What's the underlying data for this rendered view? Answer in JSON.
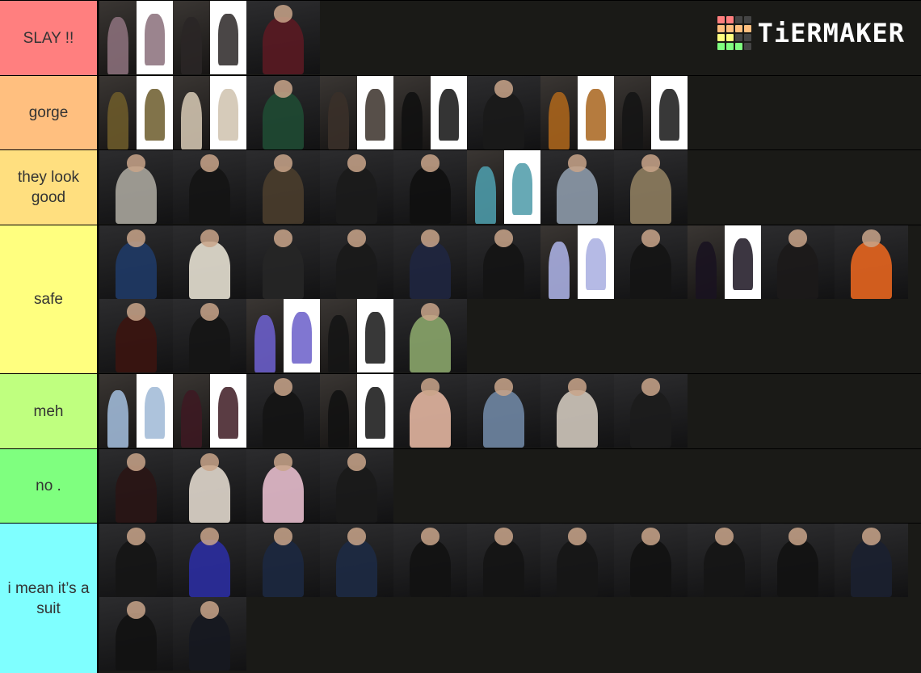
{
  "app": {
    "brand": "TiERMAKER",
    "logo_grid_colors": [
      [
        "#ff7f7f",
        "#ff7f7f",
        "#444444",
        "#444444"
      ],
      [
        "#ffbf7f",
        "#ffbf7f",
        "#ffbf7f",
        "#ffbf7f"
      ],
      [
        "#ffff7f",
        "#ffff7f",
        "#444444",
        "#444444"
      ],
      [
        "#7fff7f",
        "#7fff7f",
        "#7fff7f",
        "#444444"
      ]
    ]
  },
  "tiers": [
    {
      "label": "SLAY !!",
      "color": "#ff7f7f",
      "items": [
        {
          "kind": "split",
          "desc": "floral ball gown photo + product",
          "color": "#8a6f7a"
        },
        {
          "kind": "split",
          "desc": "black floral gown photo + product",
          "color": "#2a2626"
        },
        {
          "kind": "single",
          "desc": "red-black velvet jacket",
          "color": "#5a1a22"
        }
      ]
    },
    {
      "label": "gorge",
      "color": "#ffbf7f",
      "items": [
        {
          "kind": "split",
          "desc": "gold jacquard outfit + product",
          "color": "#6b5a2a"
        },
        {
          "kind": "split",
          "desc": "sequin slit gown + product",
          "color": "#cfc2ae"
        },
        {
          "kind": "single",
          "desc": "green satin gowns at podium",
          "color": "#1f4a33"
        },
        {
          "kind": "split",
          "desc": "lace jumpsuit on red carpet + product",
          "color": "#3a3029"
        },
        {
          "kind": "split",
          "desc": "black caped dress + product",
          "color": "#111111"
        },
        {
          "kind": "single",
          "desc": "black satin slit dress",
          "color": "#1a1a1a"
        },
        {
          "kind": "split",
          "desc": "orange-black corset set + runway",
          "color": "#a8641c"
        },
        {
          "kind": "split",
          "desc": "black ruffle gown + runway",
          "color": "#151515"
        }
      ]
    },
    {
      "label": "they look good",
      "color": "#ffdf7f",
      "items": [
        {
          "kind": "single",
          "desc": "grey blazer white tee",
          "color": "#a9a59c"
        },
        {
          "kind": "single",
          "desc": "two women in black dresses",
          "color": "#141414"
        },
        {
          "kind": "single",
          "desc": "strapless gown at podium",
          "color": "#4a3d2c"
        },
        {
          "kind": "single",
          "desc": "black leather jacket",
          "color": "#1b1b1b"
        },
        {
          "kind": "single",
          "desc": "black coat with quilted bag",
          "color": "#101010"
        },
        {
          "kind": "split",
          "desc": "teal slit gown + product",
          "color": "#4c9aa8"
        },
        {
          "kind": "single",
          "desc": "sparkly silver gowns at podium",
          "color": "#8d9aaa"
        },
        {
          "kind": "single",
          "desc": "group in gold and beige",
          "color": "#8e7d5f"
        }
      ]
    },
    {
      "label": "safe",
      "color": "#ffff7f",
      "items": [
        {
          "kind": "single",
          "desc": "blue velvet suit",
          "color": "#1f3a66"
        },
        {
          "kind": "single",
          "desc": "cream suit with mic",
          "color": "#e5e0d2"
        },
        {
          "kind": "single",
          "desc": "interview two men",
          "color": "#262626"
        },
        {
          "kind": "single",
          "desc": "black suit and black dress",
          "color": "#1a1a1a"
        },
        {
          "kind": "single",
          "desc": "velvet tux duo",
          "color": "#1f2640"
        },
        {
          "kind": "single",
          "desc": "black sequin off-shoulder",
          "color": "#141414"
        },
        {
          "kind": "split",
          "desc": "lavender dress at podium + product",
          "color": "#a8aee0"
        },
        {
          "kind": "single",
          "desc": "polka dot shirt black blazer",
          "color": "#141414"
        },
        {
          "kind": "split",
          "desc": "black tulle dress + product",
          "color": "#1a1320"
        },
        {
          "kind": "single",
          "desc": "group in black",
          "color": "#1c1a19"
        },
        {
          "kind": "single",
          "desc": "orange strapless dress",
          "color": "#e5651f"
        },
        {
          "kind": "single",
          "desc": "dark red jacket",
          "color": "#3b1410"
        },
        {
          "kind": "single",
          "desc": "black velvet blazer",
          "color": "#151515"
        },
        {
          "kind": "split",
          "desc": "purple lace outfit + product",
          "color": "#6a5ec9"
        },
        {
          "kind": "split",
          "desc": "black white-collar dress + product",
          "color": "#151515"
        },
        {
          "kind": "single",
          "desc": "green varsity jacket",
          "color": "#8aa56a"
        }
      ]
    },
    {
      "label": "meh",
      "color": "#bfff7f",
      "items": [
        {
          "kind": "split",
          "desc": "blue sequin gown + product",
          "color": "#9fb8d6"
        },
        {
          "kind": "split",
          "desc": "red-black suit + product",
          "color": "#3d1a22"
        },
        {
          "kind": "single",
          "desc": "black sequin jacket",
          "color": "#141414"
        },
        {
          "kind": "split",
          "desc": "black puff dress + product",
          "color": "#121212"
        },
        {
          "kind": "single",
          "desc": "peach slip dress",
          "color": "#e2b5a0"
        },
        {
          "kind": "single",
          "desc": "denim corset outfit",
          "color": "#6f86a3"
        },
        {
          "kind": "single",
          "desc": "group with signs",
          "color": "#cfc7bb"
        },
        {
          "kind": "single",
          "desc": "black denim jacket",
          "color": "#1c1c1c"
        }
      ]
    },
    {
      "label": "no .",
      "color": "#7fff7f",
      "items": [
        {
          "kind": "single",
          "desc": "black suit red scarf",
          "color": "#2a1515"
        },
        {
          "kind": "single",
          "desc": "western embroidered jacket",
          "color": "#e0d7cc"
        },
        {
          "kind": "single",
          "desc": "pink suit and beige dress",
          "color": "#e6bccc"
        },
        {
          "kind": "single",
          "desc": "sheer black polka dress",
          "color": "#1a1a1a"
        }
      ]
    },
    {
      "label": "i mean it’s a suit",
      "color": "#7fffff",
      "items": [
        {
          "kind": "single",
          "desc": "black suit with mic",
          "color": "#151515"
        },
        {
          "kind": "single",
          "desc": "blue suit",
          "color": "#2b2ea0"
        },
        {
          "kind": "single",
          "desc": "navy suit pink tie",
          "color": "#1c2840"
        },
        {
          "kind": "single",
          "desc": "navy suit",
          "color": "#1d2a44"
        },
        {
          "kind": "single",
          "desc": "black suit",
          "color": "#121212"
        },
        {
          "kind": "single",
          "desc": "black tux",
          "color": "#141414"
        },
        {
          "kind": "single",
          "desc": "black tux bowtie",
          "color": "#161616"
        },
        {
          "kind": "single",
          "desc": "black suit white shirt",
          "color": "#121212"
        },
        {
          "kind": "single",
          "desc": "black suit with mic",
          "color": "#151515"
        },
        {
          "kind": "single",
          "desc": "black tux bowtie",
          "color": "#121212"
        },
        {
          "kind": "single",
          "desc": "navy suit blue shirt",
          "color": "#1b2030"
        },
        {
          "kind": "single",
          "desc": "black suit waving",
          "color": "#121212"
        },
        {
          "kind": "single",
          "desc": "black suit black tie",
          "color": "#161820"
        }
      ]
    }
  ]
}
